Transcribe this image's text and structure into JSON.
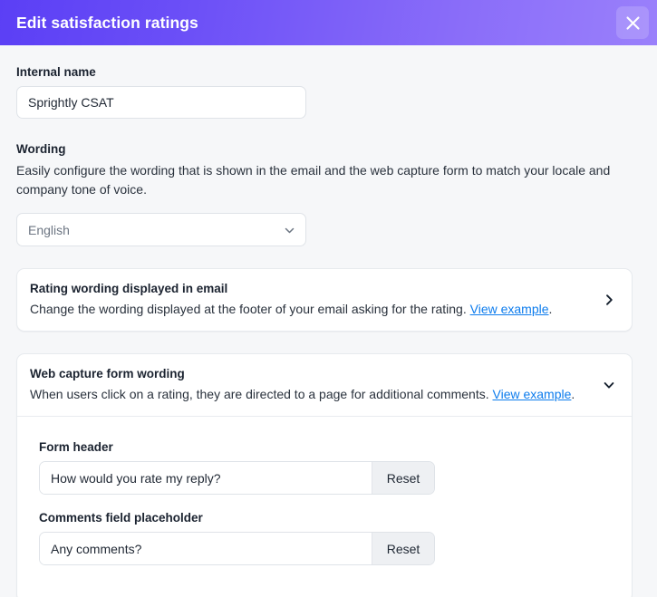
{
  "header": {
    "title": "Edit satisfaction ratings",
    "close_label": "Close",
    "gradient_from": "#5b3ff5",
    "gradient_to": "#9a80fb"
  },
  "internal_name": {
    "label": "Internal name",
    "value": "Sprightly CSAT",
    "placeholder": "Internal name"
  },
  "wording": {
    "label": "Wording",
    "description": "Easily configure the wording that is shown in the email and the web capture form to match your locale and company tone of voice.",
    "language_value": "English",
    "language_options": [
      "English"
    ]
  },
  "email_card": {
    "title": "Rating wording displayed in email",
    "description": "Change the wording displayed at the footer of your email asking for the rating.",
    "link_text": "View example",
    "trailing_period": ".",
    "chevron": "chevron-right",
    "expanded": false
  },
  "web_card": {
    "title": "Web capture form wording",
    "description": "When users click on a rating, they are directed to a page for additional comments.",
    "link_text": "View example",
    "trailing_period": ".",
    "chevron": "chevron-down",
    "expanded": true,
    "fields": [
      {
        "label": "Form header",
        "value": "How would you rate my reply?",
        "placeholder": "Form header",
        "reset_label": "Reset"
      },
      {
        "label": "Comments field placeholder",
        "value": "Any comments?",
        "placeholder": "Comments field placeholder",
        "reset_label": "Reset"
      }
    ]
  },
  "colors": {
    "link": "#0d7ced",
    "page_bg": "#f6f7f9",
    "card_bg": "#ffffff"
  }
}
